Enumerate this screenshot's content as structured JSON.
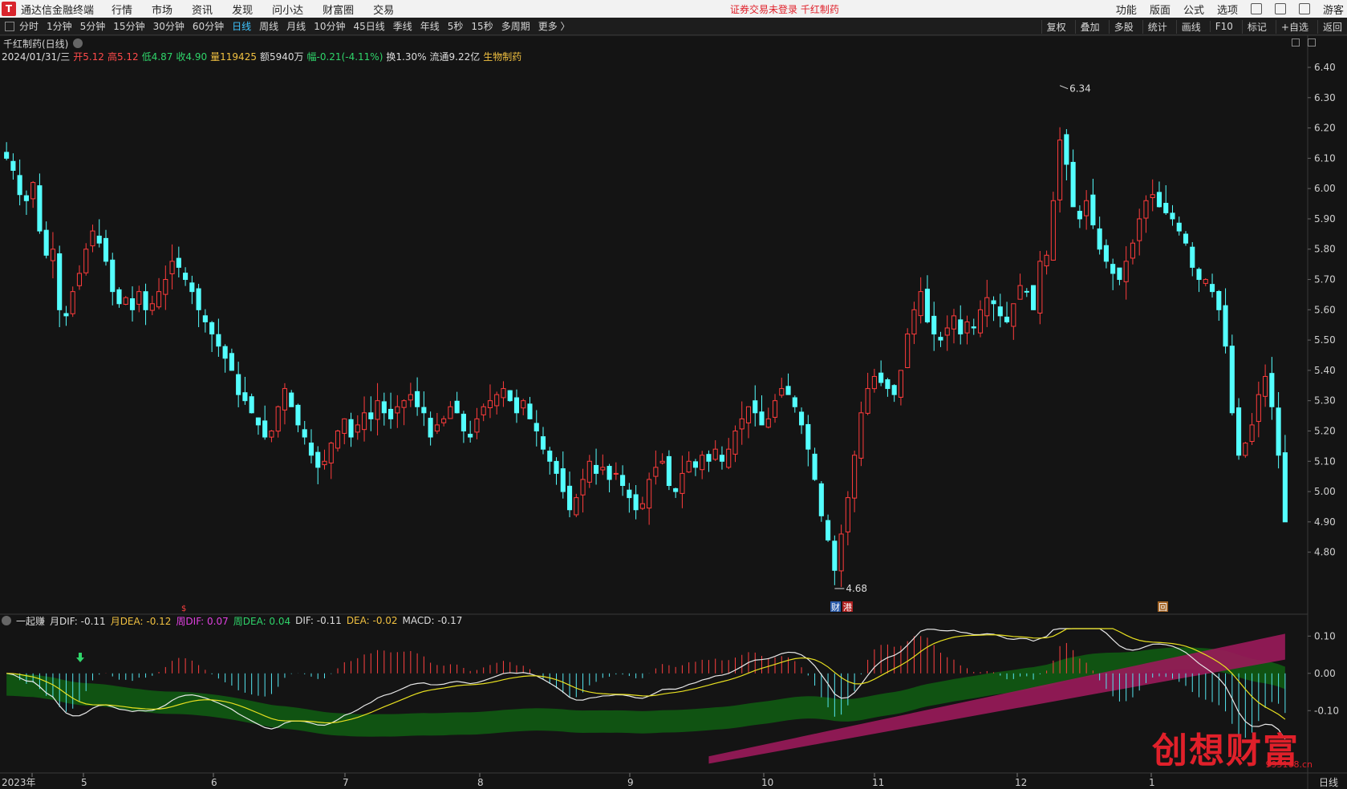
{
  "topbar": {
    "app_title": "通达信金融终端",
    "menus": [
      "行情",
      "市场",
      "资讯",
      "发现",
      "问小达",
      "财富圈",
      "交易"
    ],
    "notice": "证券交易未登录  千红制药",
    "right_items": [
      "功能",
      "版面",
      "公式",
      "选项"
    ],
    "user": "游客"
  },
  "toolbar": {
    "periods": [
      "分时",
      "1分钟",
      "5分钟",
      "15分钟",
      "30分钟",
      "60分钟",
      "日线",
      "周线",
      "月线",
      "10分钟",
      "45日线",
      "季线",
      "年线",
      "5秒",
      "15秒",
      "多周期",
      "更多 〉"
    ],
    "active_period": "日线",
    "right_items": [
      "复权",
      "叠加",
      "多股",
      "统计",
      "画线",
      "F10",
      "标记",
      "+自选",
      "返回"
    ]
  },
  "quote": {
    "title": "千红制药(日线)",
    "date": "2024/01/31/三",
    "open": "开5.12",
    "high": "高5.12",
    "low": "低4.87",
    "close": "收4.90",
    "volume": "量119425",
    "amount": "额5940万",
    "change": "幅-0.21(-4.11%)",
    "turnover": "换1.30%",
    "float_cap": "流通9.22亿",
    "sector": "生物制药"
  },
  "macd": {
    "name": "一起赚",
    "items": [
      {
        "label": "月DIF: -0.11",
        "color": "white"
      },
      {
        "label": "月DEA: -0.12",
        "color": "yellow"
      },
      {
        "label": "周DIF: 0.07",
        "color": "purple"
      },
      {
        "label": "周DEA: 0.04",
        "color": "green"
      },
      {
        "label": "DIF: -0.11",
        "color": "white"
      },
      {
        "label": "DEA: -0.02",
        "color": "yellow"
      },
      {
        "label": "MACD: -0.17",
        "color": "white"
      }
    ]
  },
  "markers": {
    "high_label": "6.34",
    "low_label": "4.68",
    "tag_cai": "财",
    "tag_gang": "港",
    "tag_misc": "回",
    "tag_small": "$"
  },
  "x_axis": {
    "labels": [
      "2023年",
      "5",
      "6",
      "7",
      "8",
      "9",
      "10",
      "11",
      "12",
      "1"
    ],
    "period_label": "日线"
  },
  "watermark": {
    "text": "创想财富",
    "url": "995168.cn"
  },
  "colors": {
    "up": "#ff3c3c",
    "down": "#54ffff",
    "bg": "#141414",
    "active": "#3ec4ff"
  },
  "chart_data": {
    "type": "candlestick",
    "y_ticks": [
      "6.40",
      "6.30",
      "6.20",
      "6.10",
      "6.00",
      "5.90",
      "5.80",
      "5.70",
      "5.60",
      "5.50",
      "5.40",
      "5.30",
      "5.20",
      "5.10",
      "5.00",
      "4.90",
      "4.80"
    ],
    "ylim": [
      4.68,
      6.4
    ],
    "macd_ticks": [
      "0.10",
      "0.00",
      "-0.10"
    ],
    "macd_ylim": [
      -0.25,
      0.12
    ],
    "closes": [
      6.1,
      6.06,
      5.98,
      5.96,
      6.02,
      5.86,
      5.78,
      5.8,
      5.6,
      5.58,
      5.66,
      5.72,
      5.8,
      5.86,
      5.82,
      5.76,
      5.66,
      5.62,
      5.64,
      5.6,
      5.66,
      5.6,
      5.62,
      5.66,
      5.7,
      5.76,
      5.74,
      5.7,
      5.66,
      5.6,
      5.56,
      5.52,
      5.48,
      5.44,
      5.4,
      5.32,
      5.3,
      5.26,
      5.22,
      5.18,
      5.2,
      5.28,
      5.34,
      5.28,
      5.22,
      5.18,
      5.12,
      5.08,
      5.1,
      5.16,
      5.2,
      5.24,
      5.18,
      5.22,
      5.26,
      5.24,
      5.3,
      5.26,
      5.24,
      5.28,
      5.3,
      5.32,
      5.28,
      5.26,
      5.18,
      5.22,
      5.24,
      5.28,
      5.26,
      5.2,
      5.18,
      5.24,
      5.28,
      5.3,
      5.32,
      5.34,
      5.3,
      5.26,
      5.3,
      5.24,
      5.2,
      5.14,
      5.1,
      5.06,
      5.0,
      4.94,
      4.98,
      5.04,
      5.1,
      5.06,
      5.08,
      5.04,
      5.06,
      5.02,
      4.98,
      4.94,
      4.96,
      5.04,
      5.08,
      5.1,
      5.02,
      5.0,
      5.06,
      5.1,
      5.08,
      5.12,
      5.1,
      5.14,
      5.1,
      5.14,
      5.2,
      5.24,
      5.28,
      5.26,
      5.22,
      5.24,
      5.3,
      5.34,
      5.32,
      5.28,
      5.22,
      5.14,
      5.04,
      4.92,
      4.84,
      4.74,
      4.86,
      4.98,
      5.12,
      5.26,
      5.34,
      5.38,
      5.36,
      5.34,
      5.32,
      5.4,
      5.52,
      5.6,
      5.66,
      5.56,
      5.52,
      5.5,
      5.54,
      5.58,
      5.52,
      5.56,
      5.54,
      5.6,
      5.64,
      5.62,
      5.58,
      5.56,
      5.62,
      5.68,
      5.66,
      5.6,
      5.76,
      5.78,
      5.96,
      6.16,
      6.08,
      5.94,
      5.9,
      5.96,
      5.88,
      5.8,
      5.76,
      5.72,
      5.7,
      5.76,
      5.82,
      5.9,
      5.96,
      5.98,
      5.94,
      5.92,
      5.9,
      5.86,
      5.82,
      5.74,
      5.7,
      5.7,
      5.66,
      5.6,
      5.48,
      5.26,
      5.12,
      5.16,
      5.22,
      5.32,
      5.38,
      5.28,
      5.12,
      4.9
    ]
  }
}
